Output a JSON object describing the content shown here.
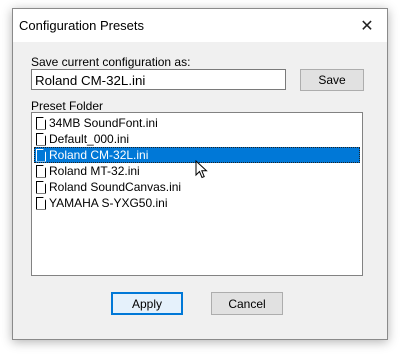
{
  "window": {
    "title": "Configuration Presets",
    "close_symbol": "✕"
  },
  "save_section": {
    "label": "Save current configuration as:",
    "value": "Roland CM-32L.ini",
    "save_label": "Save"
  },
  "folder": {
    "label": "Preset Folder",
    "items": [
      {
        "label": "34MB SoundFont.ini"
      },
      {
        "label": "Default_000.ini"
      },
      {
        "label": "Roland CM-32L.ini",
        "selected": true
      },
      {
        "label": "Roland MT-32.ini"
      },
      {
        "label": "Roland SoundCanvas.ini"
      },
      {
        "label": "YAMAHA S-YXG50.ini"
      }
    ]
  },
  "buttons": {
    "apply_label": "Apply",
    "cancel_label": "Cancel"
  },
  "colors": {
    "selection": "#0078d7",
    "dialog_bg": "#f0f0f0"
  }
}
